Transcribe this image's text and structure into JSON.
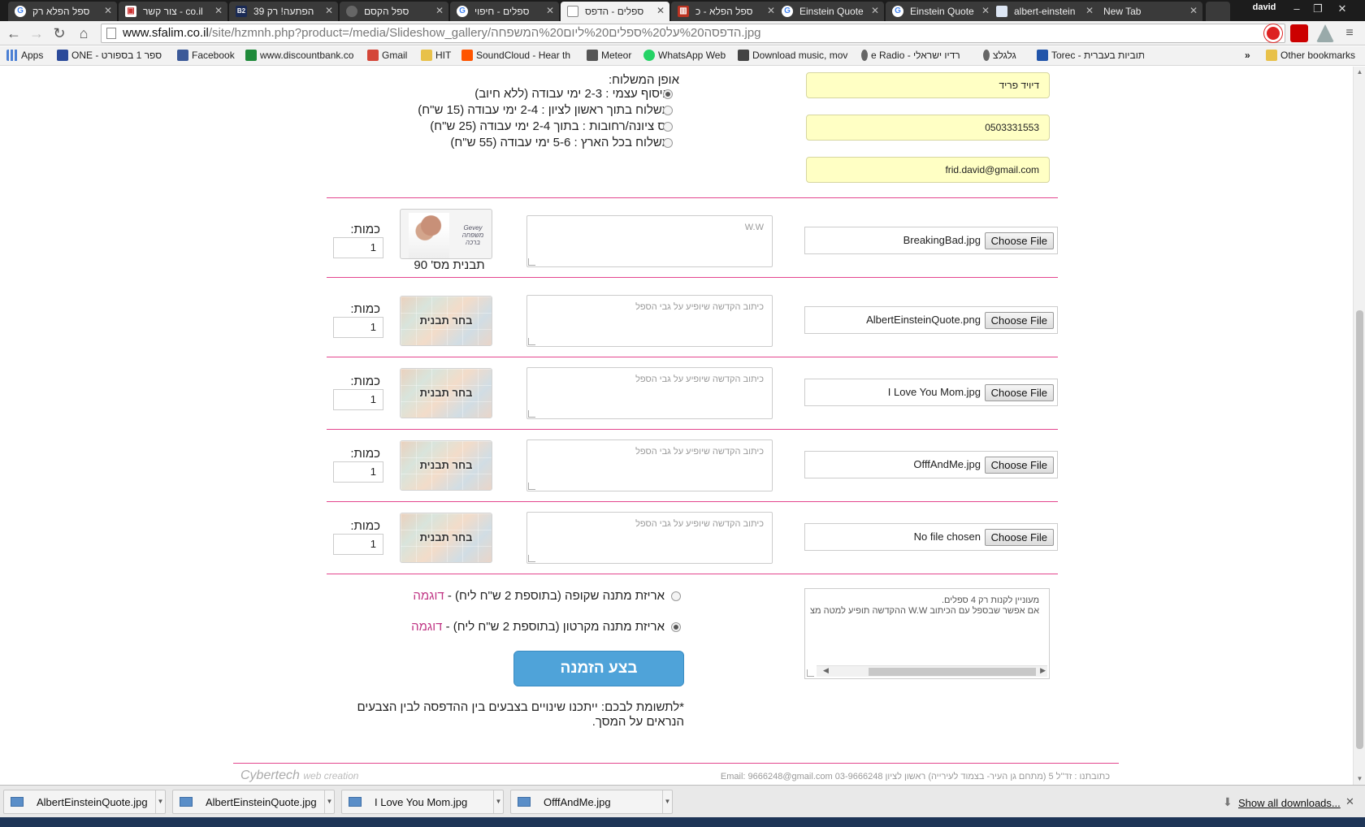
{
  "browser": {
    "tabs": [
      {
        "title": "ספל הפלא רק",
        "icon": "google-icon",
        "icon_text": "G",
        "active": false
      },
      {
        "title": "צור קשר - co.il",
        "icon": "image-favicon",
        "icon_text": "▣",
        "active": false
      },
      {
        "title": "הפתעה! רק 39",
        "icon": "b2-favicon",
        "icon_text": "B2",
        "active": false
      },
      {
        "title": "ספל הקסם",
        "icon": "blank-favicon",
        "icon_text": "",
        "active": false
      },
      {
        "title": "ספלים - חיפוי",
        "icon": "google-icon",
        "icon_text": "G",
        "active": false
      },
      {
        "title": "ספלים - הדפס",
        "icon": "page-favicon",
        "icon_text": "",
        "active": true
      },
      {
        "title": "ספל הפלא - כ",
        "icon": "store-favicon",
        "icon_text": "▥",
        "active": false
      },
      {
        "title": "Einstein Quote",
        "icon": "google-icon",
        "icon_text": "G",
        "active": false
      },
      {
        "title": "Einstein Quote",
        "icon": "google-icon",
        "icon_text": "G",
        "active": false
      },
      {
        "title": "albert-einstein",
        "icon": "page-favicon",
        "icon_text": "",
        "active": false
      },
      {
        "title": "New Tab",
        "icon": "none",
        "icon_text": "",
        "active": false
      }
    ],
    "user": "david",
    "url_host": "www.sfalim.co.il",
    "url_path": "/site/hzmnh.php?product=/media/Slideshow_gallery/הדפסה%20על%20ספלים%20ליום%20המשפחה.jpg",
    "bookmarks": [
      {
        "label": "Apps",
        "icon": "apps-grid-icon",
        "color": "#4a7fd4"
      },
      {
        "label": "ONE - ספר 1 בספורט",
        "icon": "one-favicon",
        "color": "#2b4a9a"
      },
      {
        "label": "Facebook",
        "icon": "facebook-icon",
        "color": "#3b5998"
      },
      {
        "label": "www.discountbank.co",
        "icon": "discount-bank-icon",
        "color": "#1f8a3a"
      },
      {
        "label": "Gmail",
        "icon": "gmail-icon",
        "color": "#d44638"
      },
      {
        "label": "HIT",
        "icon": "folder-icon",
        "color": "#e8c14a"
      },
      {
        "label": "SoundCloud - Hear th",
        "icon": "soundcloud-icon",
        "color": "#ff5500"
      },
      {
        "label": "Meteor",
        "icon": "meteor-icon",
        "color": "#555555"
      },
      {
        "label": "WhatsApp Web",
        "icon": "whatsapp-icon",
        "color": "#25d366"
      },
      {
        "label": "Download music, mov",
        "icon": "monitor-icon",
        "color": "#444444"
      },
      {
        "label": "e Radio - רדיו ישראלי",
        "icon": "mic-icon",
        "color": "#666666"
      },
      {
        "label": "גלגלצ",
        "icon": "mic-icon",
        "color": "#666666"
      },
      {
        "label": "Torec - כתוביות בעברית",
        "icon": "torec-icon",
        "color": "#2255aa"
      }
    ],
    "bookmarks_more": "»",
    "other_bookmarks": "Other bookmarks"
  },
  "form": {
    "shipping_title": "אופן המשלוח:",
    "shipping_options": [
      {
        "label": "איסוף עצמי : 2-3 ימי עבודה (ללא חיוב)",
        "selected": true
      },
      {
        "label": "משלוח בתוך ראשון לציון : 2-4 ימי עבודה (15 ש\"ח)",
        "selected": false
      },
      {
        "label": "נס ציונה/רחובות : בתוך 2-4 ימי עבודה (25 ש\"ח)",
        "selected": false
      },
      {
        "label": "משלוח בכל הארץ : 5-6 ימי עבודה (55 ש\"ח)",
        "selected": false
      }
    ],
    "name": "דיויד פריד",
    "phone": "0503331553",
    "email": "frid.david@gmail.com",
    "choose_file_label": "Choose File",
    "qty_label": "כמות:",
    "dedication_placeholder": "כיתוב הקדשה שיופיע על גבי הספל",
    "choose_template_label": "בחר תבנית",
    "rows": [
      {
        "file": "BreakingBad.jpg",
        "dedication": "W.W",
        "qty": "1",
        "template_caption": "תבנית מס' 90",
        "template_text": "Gevey משפחה ברכה"
      },
      {
        "file": "AlbertEinsteinQuote.png",
        "dedication": "",
        "qty": "1",
        "template_caption": ""
      },
      {
        "file": "I Love You Mom.jpg",
        "dedication": "",
        "qty": "1",
        "template_caption": ""
      },
      {
        "file": "OfffAndMe.jpg",
        "dedication": "",
        "qty": "1",
        "template_caption": ""
      },
      {
        "file": "No file chosen",
        "dedication": "",
        "qty": "1",
        "template_caption": ""
      }
    ],
    "notes_lines": [
      "מעוניין לקנות רק 4 ספלים.",
      "אם אפשר שבספל עם הכיתוב W.W  ההקדשה תופיע למטה מצ"
    ],
    "wrap_options": [
      {
        "label": "אריזת מתנה שקופה (בתוספת 2 ש\"ח ליח) - ",
        "example": "דוגמה",
        "selected": false
      },
      {
        "label": "אריזת מתנה מקרטון (בתוספת 2 ש\"ח ליח) - ",
        "example": "דוגמה",
        "selected": true
      }
    ],
    "submit_label": "בצע הזמנה",
    "notice": "*לתשומת לבכם: ייתכנו שינויים בצבעים בין ההדפסה לבין הצבעים הנראים על המסך."
  },
  "footer": {
    "brand": "Cybertech",
    "brand_sub": "web creation",
    "contact": "כתובתנו : זד\"ל 5 (מתחם גן העיר- בצמוד לעירייה) ראשון לציון 03-9666248 Email: 9666248@gmail.com"
  },
  "downloads": {
    "items": [
      "AlbertEinsteinQuote.jpg",
      "AlbertEinsteinQuote.jpg",
      "I Love You Mom.jpg",
      "OfffAndMe.jpg"
    ],
    "show_all": "Show all downloads...",
    "close": "✕"
  },
  "colors": {
    "divider": "#e4468e",
    "field_bg": "#ffffc4",
    "button": "#4fa3d9",
    "example_link": "#c03584"
  }
}
